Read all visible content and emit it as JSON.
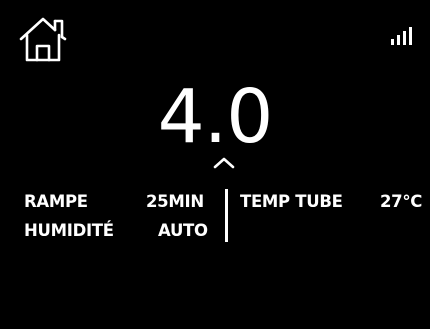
{
  "header": {
    "home_icon": "home-icon",
    "signal_icon": "signal-strength-icon"
  },
  "main": {
    "value": "4.0",
    "up_icon": "chevron-up-icon"
  },
  "params": {
    "left": [
      {
        "label": "RAMPE",
        "value": "25MIN"
      },
      {
        "label": "HUMIDITÉ",
        "value": "AUTO"
      }
    ],
    "right": [
      {
        "label": "TEMP TUBE",
        "value": "27°C"
      }
    ]
  }
}
